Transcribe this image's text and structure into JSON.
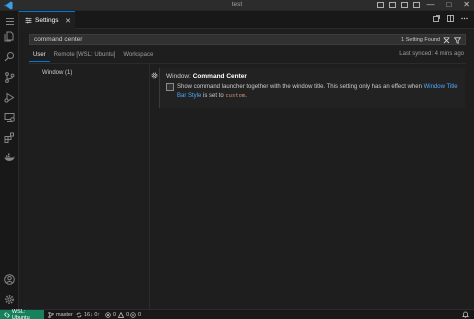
{
  "window": {
    "title": "test",
    "controls": [
      "—",
      "□",
      "✕"
    ]
  },
  "editor": {
    "tab_label": "Settings",
    "tab_close": "✕"
  },
  "settings": {
    "search_value": "command center",
    "result_count": "1 Setting Found",
    "scopes": [
      "User",
      "Remote [WSL: Ubuntu]",
      "Workspace"
    ],
    "active_scope": "User",
    "last_synced": "Last synced: 4 mins ago",
    "toc": [
      "Window (1)"
    ],
    "items": [
      {
        "title_category": "Window: ",
        "title_name": "Command Center",
        "checked": false,
        "description_part1": "Show command launcher together with the window title. This setting only has an effect when ",
        "description_link": "Window Title Bar Style",
        "description_part2": " is set to ",
        "description_code": "custom",
        "description_end": "."
      }
    ]
  },
  "statusbar": {
    "remote": "WSL: Ubuntu",
    "branch": "master",
    "sync": "16↓ 0↑",
    "errors": "0",
    "warnings": "0",
    "ports": "0"
  },
  "colors": {
    "accent": "#0078d4",
    "remote_bg": "#16825d",
    "link": "#4daafc"
  }
}
